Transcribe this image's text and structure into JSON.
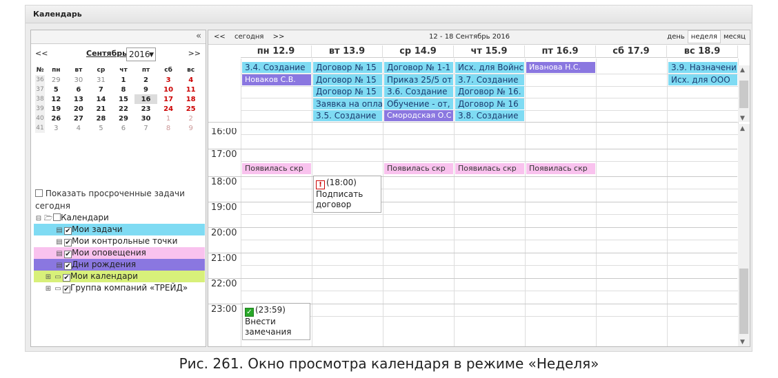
{
  "window": {
    "title": "Календарь",
    "collapse": "«"
  },
  "mini": {
    "prev": "<<",
    "next": ">>",
    "month": "Сентябрь",
    "year": "2016",
    "headers": [
      "№",
      "пн",
      "вт",
      "ср",
      "чт",
      "пт",
      "сб",
      "вс"
    ],
    "weeks": [
      [
        "36",
        "29",
        "30",
        "31",
        "1",
        "2",
        "3",
        "4"
      ],
      [
        "37",
        "5",
        "6",
        "7",
        "8",
        "9",
        "10",
        "11"
      ],
      [
        "38",
        "12",
        "13",
        "14",
        "15",
        "16",
        "17",
        "18"
      ],
      [
        "39",
        "19",
        "20",
        "21",
        "22",
        "23",
        "24",
        "25"
      ],
      [
        "40",
        "26",
        "27",
        "28",
        "29",
        "30",
        "1",
        "2"
      ],
      [
        "41",
        "3",
        "4",
        "5",
        "6",
        "7",
        "8",
        "9"
      ]
    ]
  },
  "overdue": "Показать просроченные задачи сегодня",
  "tree": [
    {
      "label": "Календари",
      "color": "#ffffff"
    },
    {
      "label": "Мои задачи",
      "color": "#7fdbf3"
    },
    {
      "label": "Мои контрольные точки",
      "color": "#ffffff"
    },
    {
      "label": "Мои оповещения",
      "color": "#f9c2ee"
    },
    {
      "label": "Дни рождения",
      "color": "#8a77e0"
    },
    {
      "label": "Мои календари",
      "color": "#d8f07a"
    },
    {
      "label": "Группа компаний «ТРЕЙД»",
      "color": "#ffffff"
    }
  ],
  "toolbar": {
    "prev": "<<",
    "today": "сегодня",
    "next": ">>",
    "range": "12 - 18 Сентябрь 2016",
    "views": [
      "день",
      "неделя",
      "месяц"
    ]
  },
  "days": [
    "пн 12.9",
    "вт 13.9",
    "ср 14.9",
    "чт 15.9",
    "пт 16.9",
    "сб 17.9",
    "вс 18.9"
  ],
  "hours": [
    "16:00",
    "17:00",
    "18:00",
    "19:00",
    "20:00",
    "21:00",
    "22:00",
    "23:00"
  ],
  "allday_events": [
    {
      "day": 0,
      "row": 0,
      "text": "3.4. Создание",
      "kind": "cy"
    },
    {
      "day": 0,
      "row": 1,
      "text": "Новаков С.В.",
      "kind": "pu"
    },
    {
      "day": 1,
      "row": 0,
      "text": "Договор № 15",
      "kind": "cy"
    },
    {
      "day": 1,
      "row": 1,
      "text": "Договор № 15",
      "kind": "cy"
    },
    {
      "day": 1,
      "row": 2,
      "text": "Договор № 15",
      "kind": "cy"
    },
    {
      "day": 1,
      "row": 3,
      "text": "Заявка на опла",
      "kind": "cy"
    },
    {
      "day": 1,
      "row": 4,
      "text": "3.5. Создание",
      "kind": "cy"
    },
    {
      "day": 2,
      "row": 0,
      "text": "Договор № 1-1",
      "kind": "cy"
    },
    {
      "day": 2,
      "row": 1,
      "text": "Приказ 25/5 от",
      "kind": "cy"
    },
    {
      "day": 2,
      "row": 2,
      "text": "3.6. Создание",
      "kind": "cy"
    },
    {
      "day": 2,
      "row": 3,
      "text": "Обучение - от,",
      "kind": "cy"
    },
    {
      "day": 2,
      "row": 4,
      "text": "Смородская О.С",
      "kind": "pu"
    },
    {
      "day": 3,
      "row": 0,
      "text": "Исх. для Войнс",
      "kind": "cy"
    },
    {
      "day": 3,
      "row": 1,
      "text": "3.7. Создание",
      "kind": "cy"
    },
    {
      "day": 3,
      "row": 2,
      "text": "Договор № 16.",
      "kind": "cy"
    },
    {
      "day": 3,
      "row": 3,
      "text": "Договор № 16",
      "kind": "cy"
    },
    {
      "day": 3,
      "row": 4,
      "text": "3.8. Создание",
      "kind": "cy"
    },
    {
      "day": 4,
      "row": 0,
      "text": "Иванова Н.С.",
      "kind": "pu"
    },
    {
      "day": 6,
      "row": 0,
      "text": "3.9. Назначени",
      "kind": "cy"
    },
    {
      "day": 6,
      "row": 1,
      "text": "Исх. для ООО",
      "kind": "cy"
    }
  ],
  "notifications": [
    {
      "day": 0,
      "text": "Появилась скр"
    },
    {
      "day": 2,
      "text": "Появилась скр"
    },
    {
      "day": 3,
      "text": "Появилась скр"
    },
    {
      "day": 4,
      "text": "Появилась скр"
    }
  ],
  "tasks": [
    {
      "day": 1,
      "time": "(18:00)",
      "l1": "Подписать",
      "l2": "договор",
      "status": "!"
    },
    {
      "day": 0,
      "time": "(23:59)",
      "l1": "Внести",
      "l2": "замечания",
      "status": "✓"
    }
  ],
  "caption": "Рис. 261. Окно просмотра календаря в режиме «Неделя»"
}
